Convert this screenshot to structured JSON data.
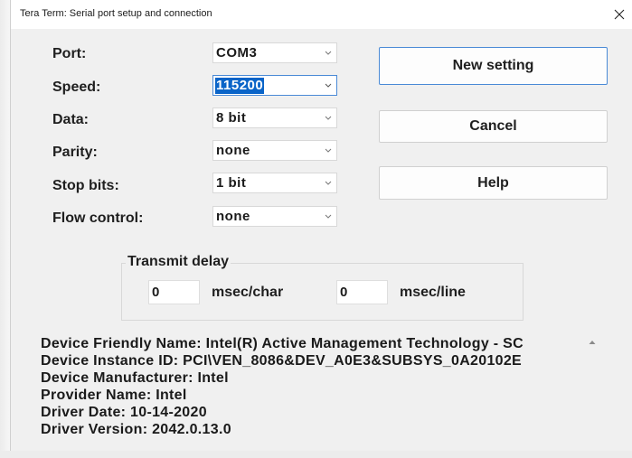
{
  "window": {
    "title": "Tera Term: Serial port setup and connection"
  },
  "icons": {
    "close": "close-icon",
    "dropdown": "chevron-down-icon",
    "scroll_up": "scroll-up-arrow-icon"
  },
  "colors": {
    "selection": "#0a64c8",
    "focus_border": "#4a8ad6",
    "dialog_bg": "#f0f0f0"
  },
  "fields": {
    "port": {
      "label": "Port:",
      "value": "COM3"
    },
    "speed": {
      "label": "Speed:",
      "value": "115200"
    },
    "data": {
      "label": "Data:",
      "value": "8 bit"
    },
    "parity": {
      "label": "Parity:",
      "value": "none"
    },
    "stop_bits": {
      "label": "Stop bits:",
      "value": "1 bit"
    },
    "flow_control": {
      "label": "Flow control:",
      "value": "none"
    }
  },
  "buttons": {
    "new_setting": "New setting",
    "cancel": "Cancel",
    "help": "Help"
  },
  "transmit_delay": {
    "label": "Transmit delay",
    "char_value": "0",
    "char_unit": "msec/char",
    "line_value": "0",
    "line_unit": "msec/line"
  },
  "device_info": [
    "Device Friendly Name: Intel(R) Active Management Technology - SC",
    "Device Instance ID: PCI\\VEN_8086&DEV_A0E3&SUBSYS_0A20102E",
    "Device Manufacturer: Intel",
    "Provider Name: Intel",
    "Driver Date: 10-14-2020",
    "Driver Version: 2042.0.13.0"
  ]
}
